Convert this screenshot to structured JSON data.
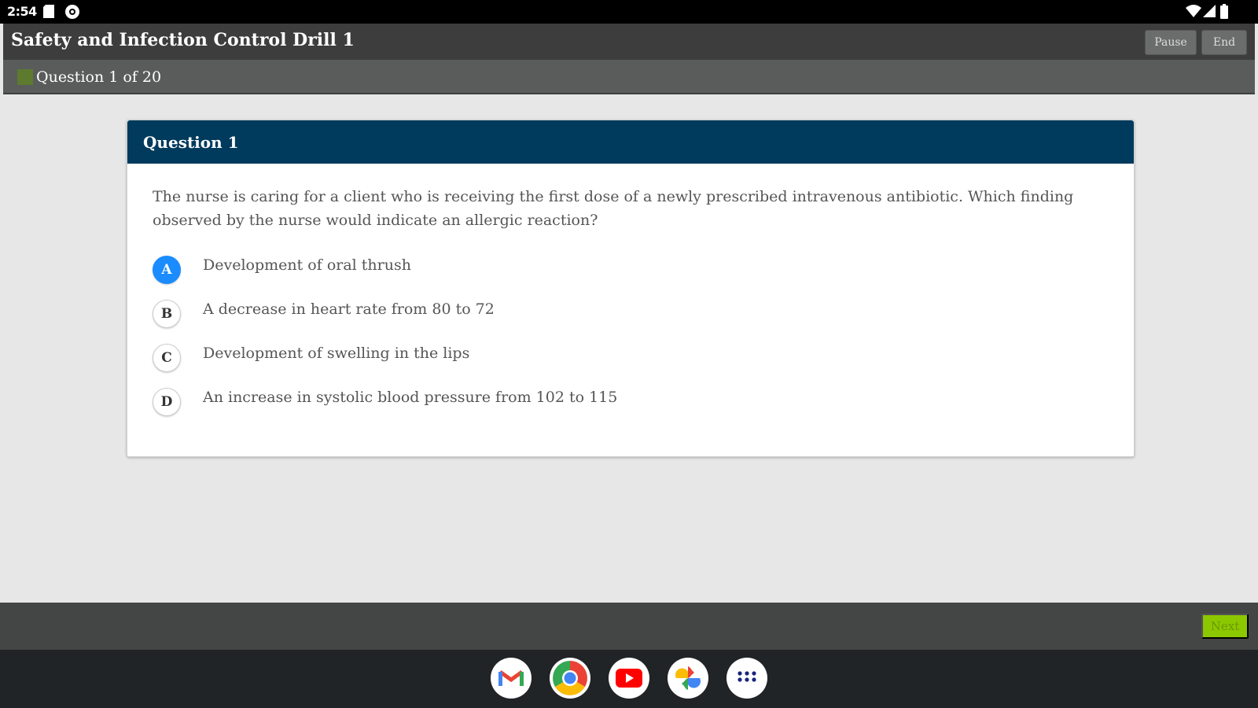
{
  "status_bar": {
    "time": "2:54",
    "left_icons": [
      "sd-card-icon",
      "settings-icon"
    ],
    "right_icons": [
      "wifi-icon",
      "cellular-icon",
      "battery-icon"
    ]
  },
  "header": {
    "title": "Safety and Infection Control Drill 1",
    "pause_label": "Pause",
    "end_label": "End",
    "progress_text": "Question 1 of 20"
  },
  "question": {
    "header": "Question 1",
    "text": "The nurse is caring for a client who is receiving the first dose of a newly prescribed intravenous antibiotic. Which finding observed by the nurse would indicate an allergic reaction?",
    "options": [
      {
        "letter": "A",
        "text": "Development of oral thrush",
        "selected": true
      },
      {
        "letter": "B",
        "text": "A decrease in heart rate from 80 to 72",
        "selected": false
      },
      {
        "letter": "C",
        "text": "Development of swelling in the lips",
        "selected": false
      },
      {
        "letter": "D",
        "text": "An increase in systolic blood pressure from 102 to 115",
        "selected": false
      }
    ]
  },
  "footer": {
    "next_label": "Next"
  },
  "dock": {
    "apps": [
      "gmail-icon",
      "chrome-icon",
      "youtube-icon",
      "photos-icon",
      "app-launcher-icon"
    ]
  },
  "colors": {
    "question_header_bg": "#003a5c",
    "selected_option": "#1a8cff",
    "next_button": "#8cc800"
  }
}
